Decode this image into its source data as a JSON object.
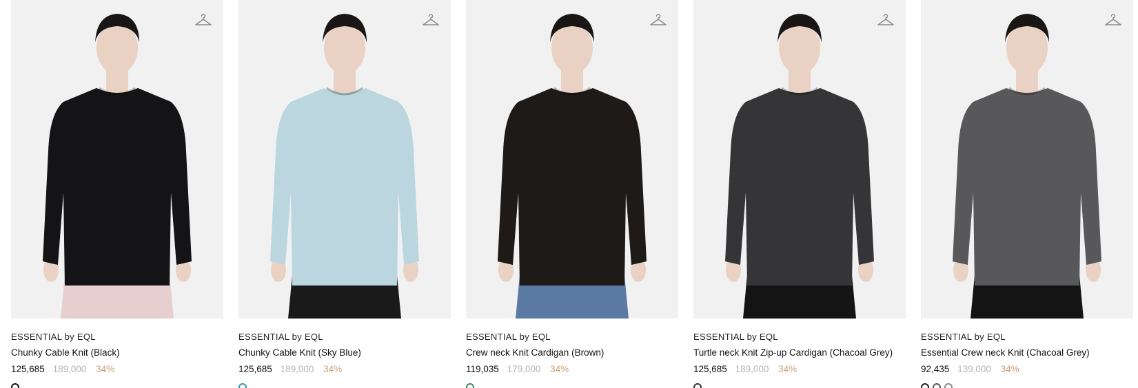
{
  "icons": {
    "wishlist": "hanger-icon"
  },
  "products": [
    {
      "brand": "ESSENTIAL by EQL",
      "name": "Chunky Cable Knit (Black)",
      "price": "125,685",
      "original_price": "189,000",
      "discount": "34%",
      "garment_color": "#141416",
      "bottom_color": "#e7cfcf",
      "swatches": [
        "#111111"
      ]
    },
    {
      "brand": "ESSENTIAL by EQL",
      "name": "Chunky Cable Knit (Sky Blue)",
      "price": "125,685",
      "original_price": "189,000",
      "discount": "34%",
      "garment_color": "#bcd6e0",
      "bottom_color": "#1a1a1a",
      "swatches": [
        "#3a8fb0"
      ]
    },
    {
      "brand": "ESSENTIAL by EQL",
      "name": "Crew neck Knit Cardigan (Brown)",
      "price": "119,035",
      "original_price": "179,000",
      "discount": "34%",
      "garment_color": "#1e1a18",
      "bottom_color": "#5b7aa3",
      "swatches": [
        "#3d8a62"
      ]
    },
    {
      "brand": "ESSENTIAL by EQL",
      "name": "Turtle neck Knit Zip-up Cardigan (Chacoal Grey)",
      "price": "125,685",
      "original_price": "189,000",
      "discount": "34%",
      "garment_color": "#353537",
      "bottom_color": "#141414",
      "swatches": [
        "#333333"
      ]
    },
    {
      "brand": "ESSENTIAL by EQL",
      "name": "Essential Crew neck Knit (Chacoal Grey)",
      "price": "92,435",
      "original_price": "139,000",
      "discount": "34%",
      "garment_color": "#58585a",
      "bottom_color": "#141414",
      "swatches": [
        "#222222",
        "#555555",
        "#888888"
      ]
    }
  ]
}
